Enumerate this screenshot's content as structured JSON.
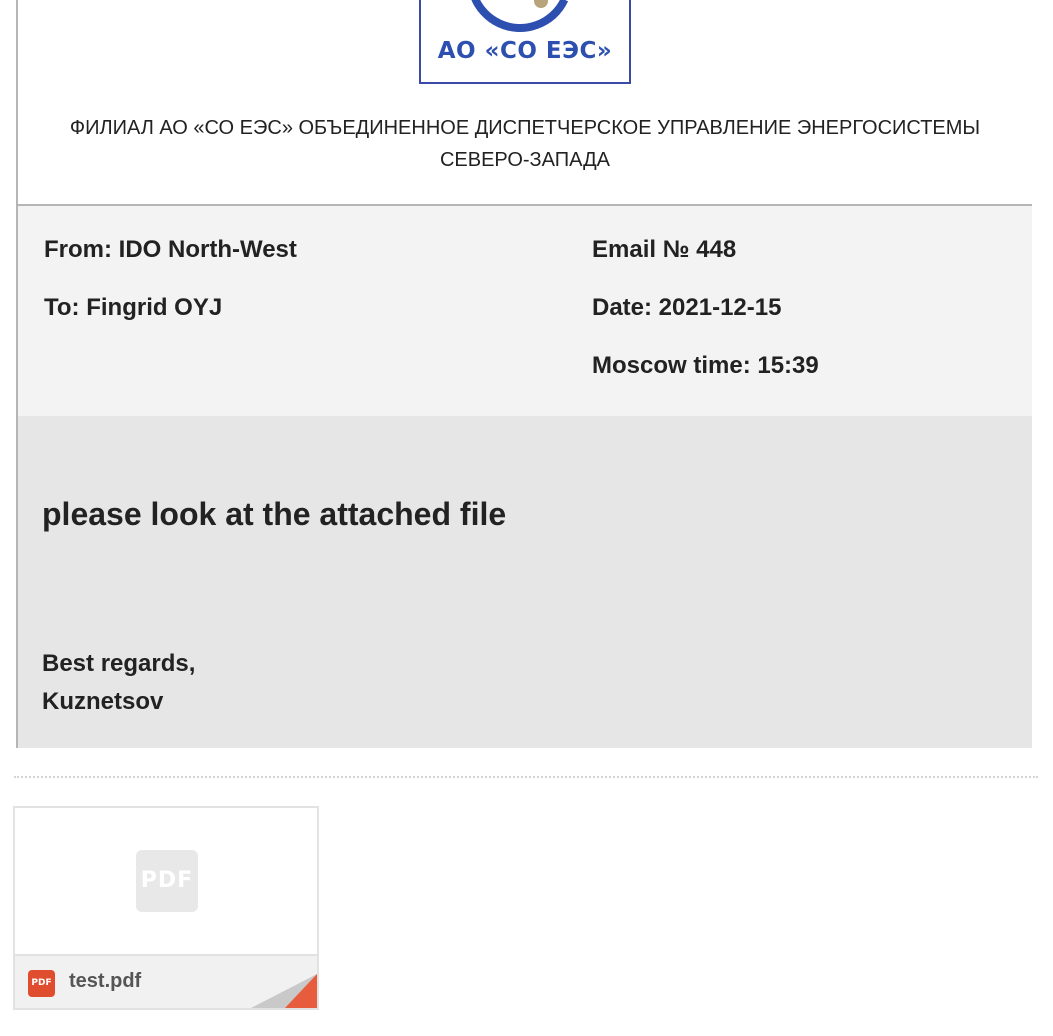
{
  "header": {
    "logo_text": "АО «СО ЕЭС»",
    "org_name": "ФИЛИАЛ АО «СО ЕЭС» ОБЪЕДИНЕННОЕ ДИСПЕТЧЕРСКОЕ УПРАВЛЕНИЕ ЭНЕРГОСИСТЕМЫ СЕВЕРО-ЗАПАДА"
  },
  "meta": {
    "from": "From: IDO North-West",
    "to": "To: Fingrid OYJ",
    "email_no": "Email № 448",
    "date": "Date: 2021-12-15",
    "moscow_time": "Moscow time: 15:39"
  },
  "body": {
    "message": "please look at the attached file",
    "signature_line1": "Best regards,",
    "signature_line2": "Kuznetsov"
  },
  "attachment": {
    "preview_icon_label": "PDF",
    "file_icon_label": "PDF",
    "file_name": "test.pdf",
    "icon": "pdf-file-icon"
  },
  "colors": {
    "brand_blue": "#2d4fb0",
    "pdf_red": "#e04d2e",
    "meta_bg": "#f4f3f4",
    "body_bg": "#e7e6e7"
  }
}
